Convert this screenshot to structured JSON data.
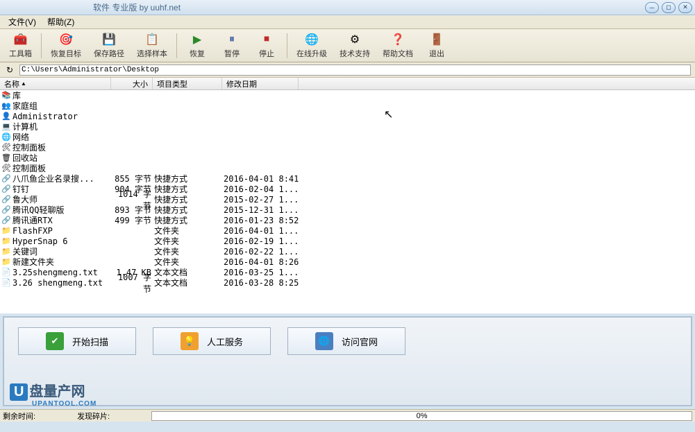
{
  "title": "软件 专业版 by uuhf.net",
  "menu": {
    "file": "文件(V)",
    "help": "帮助(Z)"
  },
  "toolbar": {
    "toolbox": "工具箱",
    "recover_target": "恢复目标",
    "save_path": "保存路径",
    "select_sample": "选择样本",
    "recover": "恢复",
    "pause": "暂停",
    "stop": "停止",
    "online_upgrade": "在线升级",
    "tech_support": "技术支持",
    "help_doc": "帮助文档",
    "exit": "退出"
  },
  "address": "C:\\Users\\Administrator\\Desktop",
  "columns": {
    "name": "名称",
    "size": "大小",
    "type": "项目类型",
    "date": "修改日期"
  },
  "rows": [
    {
      "icon": "📚",
      "name": "库",
      "size": "",
      "type": "",
      "date": ""
    },
    {
      "icon": "👥",
      "name": "家庭组",
      "size": "",
      "type": "",
      "date": ""
    },
    {
      "icon": "👤",
      "name": "Administrator",
      "size": "",
      "type": "",
      "date": ""
    },
    {
      "icon": "💻",
      "name": "计算机",
      "size": "",
      "type": "",
      "date": ""
    },
    {
      "icon": "🌐",
      "name": "网络",
      "size": "",
      "type": "",
      "date": ""
    },
    {
      "icon": "🛠",
      "name": "控制面板",
      "size": "",
      "type": "",
      "date": ""
    },
    {
      "icon": "🗑",
      "name": "回收站",
      "size": "",
      "type": "",
      "date": ""
    },
    {
      "icon": "🛠",
      "name": "控制面板",
      "size": "",
      "type": "",
      "date": ""
    },
    {
      "icon": "🔗",
      "name": "八爪鱼企业名录搜...",
      "size": "855 字节",
      "type": "快捷方式",
      "date": "2016-04-01 8:41"
    },
    {
      "icon": "🔗",
      "name": "钉钉",
      "size": "904 字节",
      "type": "快捷方式",
      "date": "2016-02-04 1..."
    },
    {
      "icon": "🔗",
      "name": "鲁大师",
      "size": "1014 字节",
      "type": "快捷方式",
      "date": "2015-02-27 1..."
    },
    {
      "icon": "🔗",
      "name": "腾讯QQ轻聊版",
      "size": "893 字节",
      "type": "快捷方式",
      "date": "2015-12-31 1..."
    },
    {
      "icon": "🔗",
      "name": "腾讯通RTX",
      "size": "499 字节",
      "type": "快捷方式",
      "date": "2016-01-23 8:52"
    },
    {
      "icon": "📁",
      "name": "FlashFXP",
      "size": "",
      "type": "文件夹",
      "date": "2016-04-01 1..."
    },
    {
      "icon": "📁",
      "name": "HyperSnap 6",
      "size": "",
      "type": "文件夹",
      "date": "2016-02-19 1..."
    },
    {
      "icon": "📁",
      "name": "关键词",
      "size": "",
      "type": "文件夹",
      "date": "2016-02-22 1..."
    },
    {
      "icon": "📁",
      "name": "新建文件夹",
      "size": "",
      "type": "文件夹",
      "date": "2016-04-01 8:26"
    },
    {
      "icon": "📄",
      "name": "3.25shengmeng.txt",
      "size": "1.47 KB",
      "type": "文本文档",
      "date": "2016-03-25 1..."
    },
    {
      "icon": "📄",
      "name": "3.26 shengmeng.txt",
      "size": "1007 字节",
      "type": "文本文档",
      "date": "2016-03-28 8:25"
    }
  ],
  "bottom": {
    "scan": "开始扫描",
    "service": "人工服务",
    "website": "访问官网"
  },
  "logo": {
    "text": "盘量产网",
    "sub": "UPANTOOL.COM"
  },
  "status": {
    "remaining": "剩余时间:",
    "fragments": "发现碎片:",
    "progress": "0%"
  }
}
